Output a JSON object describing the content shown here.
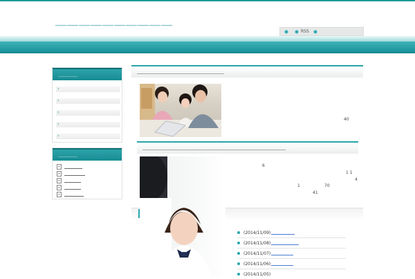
{
  "header": {
    "site_title": "＿＿＿＿＿＿＿＿＿＿",
    "nav": {
      "rss_label": "RSS"
    }
  },
  "sidebar": {
    "menu_widget": {
      "title": "＿＿＿＿",
      "items": [
        "",
        "",
        "",
        "",
        ""
      ]
    },
    "recent_widget": {
      "title": "＿＿＿＿",
      "items": [
        "",
        "",
        "",
        "",
        ""
      ]
    }
  },
  "main": {
    "section1": {
      "title": "＿＿＿＿＿＿＿＿＿＿＿＿＿＿",
      "value": "40"
    },
    "section2": {
      "title": "＿＿＿＿＿＿＿＿＿＿＿＿＿＿＿＿＿＿＿＿＿＿＿",
      "values": [
        "6",
        "1 1",
        "4",
        "1",
        "70",
        "41"
      ]
    }
  },
  "news": {
    "items": [
      {
        "date": "(2014/11/09)"
      },
      {
        "date": "(2014/11/08)"
      },
      {
        "date": "(2014/11/07)"
      },
      {
        "date": "(2014/11/06)"
      },
      {
        "date": "(2014/11/05)"
      }
    ]
  },
  "colors": {
    "accent": "#1e9a9a",
    "band": "#179098",
    "link": "#4a7bd6"
  }
}
